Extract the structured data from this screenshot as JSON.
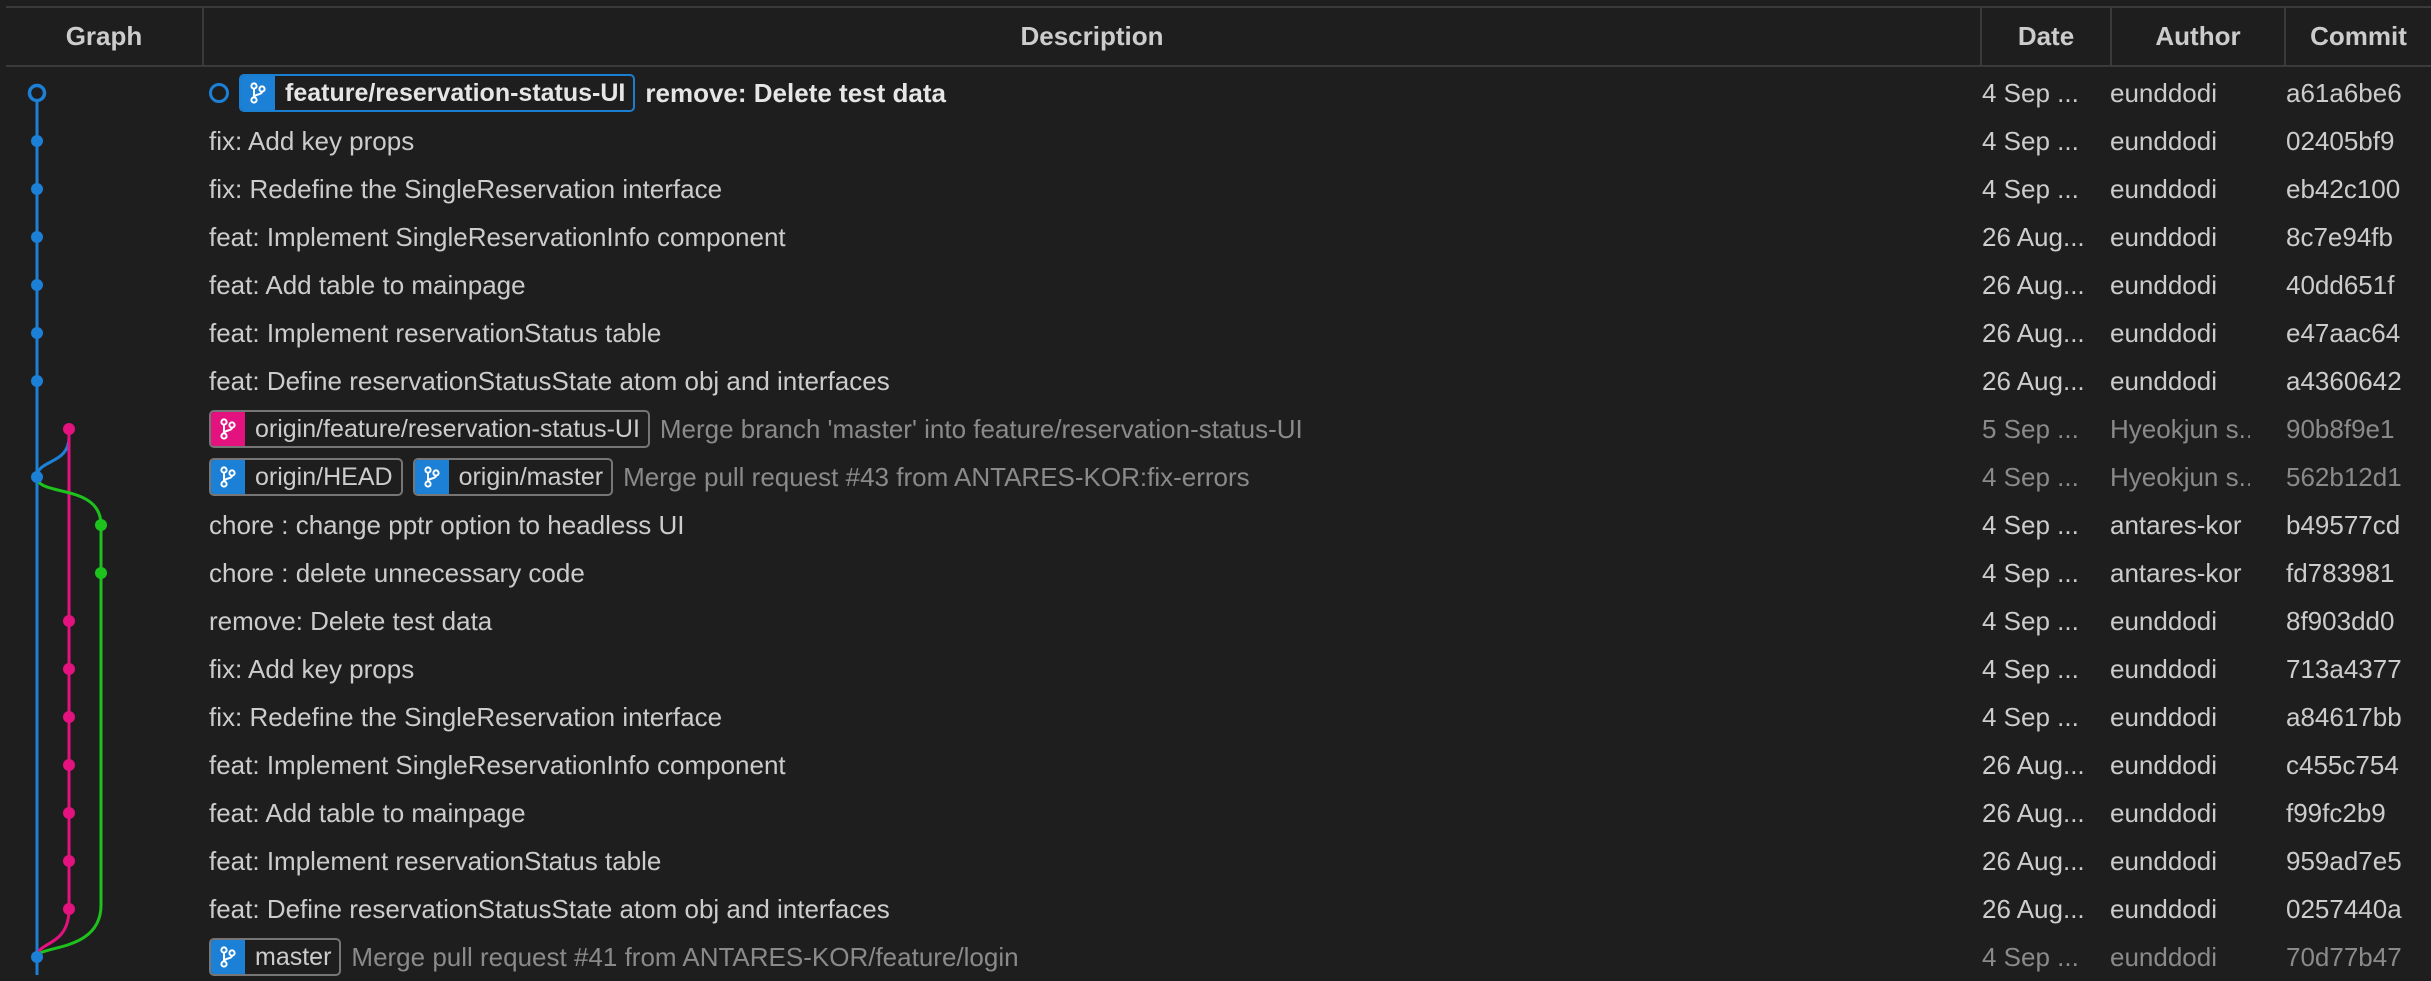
{
  "columns": {
    "graph": "Graph",
    "description": "Description",
    "date": "Date",
    "author": "Author",
    "commit": "Commit"
  },
  "colors": {
    "main_line": "#1b80d6",
    "merge_line": "#e3127f",
    "side_line": "#1dc21d",
    "background": "#1e1e1e"
  },
  "icons": {
    "branch_badge": "git-branch-icon",
    "head_marker": "head-ring-icon"
  },
  "commits": [
    {
      "badges": [
        {
          "label": "feature/reservation-status-UI",
          "color": "#1b80d6",
          "head": true
        }
      ],
      "message": "remove: Delete test data",
      "date": "4 Sep ...",
      "author": "eunddodi",
      "hash": "a61a6be6",
      "style": "bold"
    },
    {
      "badges": [],
      "message": "fix: Add key props",
      "date": "4 Sep ...",
      "author": "eunddodi",
      "hash": "02405bf9",
      "style": "normal"
    },
    {
      "badges": [],
      "message": "fix: Redefine the SingleReservation interface",
      "date": "4 Sep ...",
      "author": "eunddodi",
      "hash": "eb42c100",
      "style": "normal"
    },
    {
      "badges": [],
      "message": "feat: Implement SingleReservationInfo component",
      "date": "26 Aug...",
      "author": "eunddodi",
      "hash": "8c7e94fb",
      "style": "normal"
    },
    {
      "badges": [],
      "message": "feat: Add table to mainpage",
      "date": "26 Aug...",
      "author": "eunddodi",
      "hash": "40dd651f",
      "style": "normal"
    },
    {
      "badges": [],
      "message": "feat: Implement reservationStatus table",
      "date": "26 Aug...",
      "author": "eunddodi",
      "hash": "e47aac64",
      "style": "normal"
    },
    {
      "badges": [],
      "message": "feat: Define reservationStatusState atom obj and interfaces",
      "date": "26 Aug...",
      "author": "eunddodi",
      "hash": "a4360642",
      "style": "normal"
    },
    {
      "badges": [
        {
          "label": "origin/feature/reservation-status-UI",
          "color": "#e3127f",
          "head": false
        }
      ],
      "message": "Merge branch 'master' into feature/reservation-status-UI",
      "date": "5 Sep ...",
      "author": "Hyeokjun s...",
      "hash": "90b8f9e1",
      "style": "dim"
    },
    {
      "badges": [
        {
          "label": "origin/HEAD",
          "color": "#1b80d6",
          "head": false
        },
        {
          "label": "origin/master",
          "color": "#1b80d6",
          "head": false
        }
      ],
      "message": "Merge pull request #43 from ANTARES-KOR:fix-errors",
      "date": "4 Sep ...",
      "author": "Hyeokjun s...",
      "hash": "562b12d1",
      "style": "dim"
    },
    {
      "badges": [],
      "message": "chore : change pptr option to headless UI",
      "date": "4 Sep ...",
      "author": "antares-kor",
      "hash": "b49577cd",
      "style": "normal"
    },
    {
      "badges": [],
      "message": "chore : delete unnecessary code",
      "date": "4 Sep ...",
      "author": "antares-kor",
      "hash": "fd783981",
      "style": "normal"
    },
    {
      "badges": [],
      "message": "remove: Delete test data",
      "date": "4 Sep ...",
      "author": "eunddodi",
      "hash": "8f903dd0",
      "style": "normal"
    },
    {
      "badges": [],
      "message": "fix: Add key props",
      "date": "4 Sep ...",
      "author": "eunddodi",
      "hash": "713a4377",
      "style": "normal"
    },
    {
      "badges": [],
      "message": "fix: Redefine the SingleReservation interface",
      "date": "4 Sep ...",
      "author": "eunddodi",
      "hash": "a84617bb",
      "style": "normal"
    },
    {
      "badges": [],
      "message": "feat: Implement SingleReservationInfo component",
      "date": "26 Aug...",
      "author": "eunddodi",
      "hash": "c455c754",
      "style": "normal"
    },
    {
      "badges": [],
      "message": "feat: Add table to mainpage",
      "date": "26 Aug...",
      "author": "eunddodi",
      "hash": "f99fc2b9",
      "style": "normal"
    },
    {
      "badges": [],
      "message": "feat: Implement reservationStatus table",
      "date": "26 Aug...",
      "author": "eunddodi",
      "hash": "959ad7e5",
      "style": "normal"
    },
    {
      "badges": [],
      "message": "feat: Define reservationStatusState atom obj and interfaces",
      "date": "26 Aug...",
      "author": "eunddodi",
      "hash": "0257440a",
      "style": "normal"
    },
    {
      "badges": [
        {
          "label": "master",
          "color": "#1b80d6",
          "head": false
        }
      ],
      "message": "Merge pull request #41 from ANTARES-KOR/feature/login",
      "date": "4 Sep ...",
      "author": "eunddodi",
      "hash": "70d77b47",
      "style": "dim"
    }
  ]
}
